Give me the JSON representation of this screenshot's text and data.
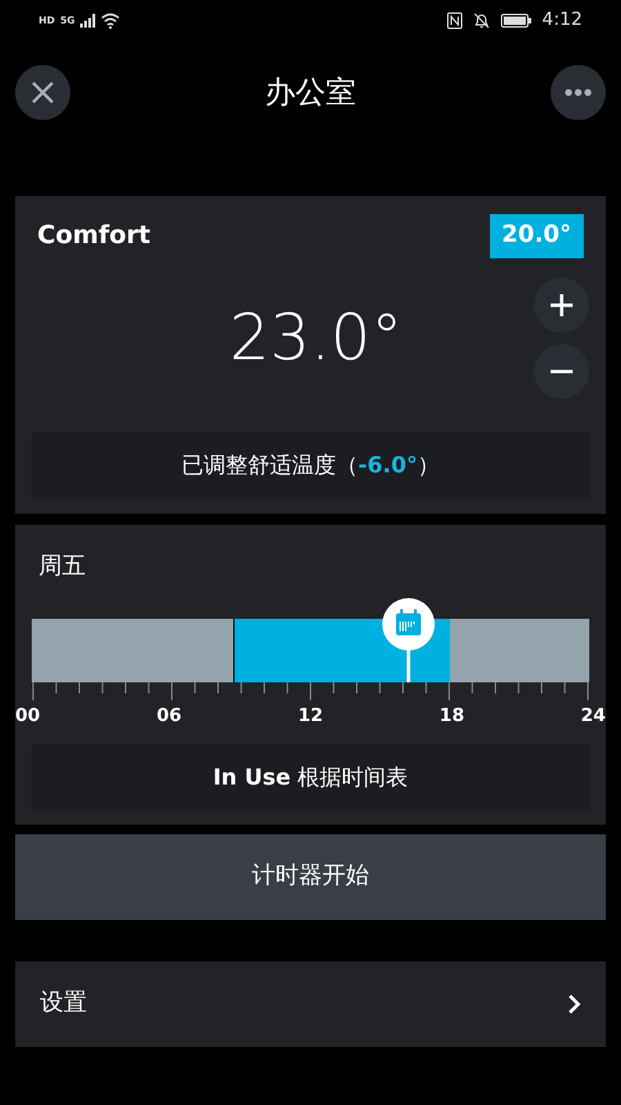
{
  "status_bar": {
    "left": [
      "HD",
      "5G"
    ],
    "time": "4:12"
  },
  "header": {
    "title": "办公室"
  },
  "comfort": {
    "label": "Comfort",
    "setpoint": "20.0°",
    "temperature": "23.0°",
    "note": "已调整舒适温度（**-6.0°**）"
  },
  "schedule": {
    "day": "周五",
    "segments": [
      {
        "kind": "off",
        "level": 0.363
      },
      {
        "kind": "comfort",
        "level": 0.75
      }
    ],
    "marker": {
      "level": 0.675
    },
    "tick_labels": [
      "00",
      "06",
      "12",
      "18",
      "24"
    ],
    "mode": "**In Use** 根据时间表"
  },
  "timer_button": "计时器开始",
  "settings": {
    "label": "设置"
  }
}
